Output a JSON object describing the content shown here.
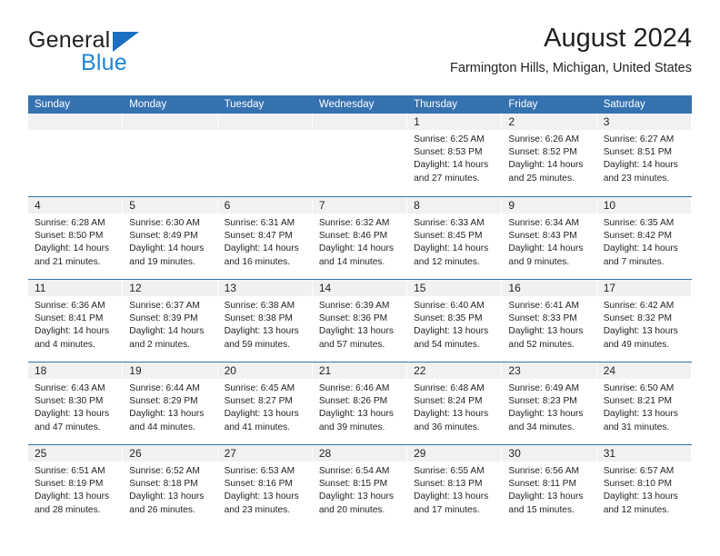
{
  "brand": {
    "name_top": "General",
    "name_bottom": "Blue",
    "triangle_color": "#1b6ec2",
    "blue_color": "#1b86d8"
  },
  "header": {
    "title": "August 2024",
    "subtitle": "Farmington Hills, Michigan, United States"
  },
  "theme": {
    "header_bar": "#3572b0",
    "day_head_bg": "#f1f1f1",
    "text": "#231f20"
  },
  "weekdays": [
    "Sunday",
    "Monday",
    "Tuesday",
    "Wednesday",
    "Thursday",
    "Friday",
    "Saturday"
  ],
  "weeks": [
    [
      {
        "day": "",
        "lines": []
      },
      {
        "day": "",
        "lines": []
      },
      {
        "day": "",
        "lines": []
      },
      {
        "day": "",
        "lines": []
      },
      {
        "day": "1",
        "lines": [
          "Sunrise: 6:25 AM",
          "Sunset: 8:53 PM",
          "Daylight: 14 hours",
          "and 27 minutes."
        ]
      },
      {
        "day": "2",
        "lines": [
          "Sunrise: 6:26 AM",
          "Sunset: 8:52 PM",
          "Daylight: 14 hours",
          "and 25 minutes."
        ]
      },
      {
        "day": "3",
        "lines": [
          "Sunrise: 6:27 AM",
          "Sunset: 8:51 PM",
          "Daylight: 14 hours",
          "and 23 minutes."
        ]
      }
    ],
    [
      {
        "day": "4",
        "lines": [
          "Sunrise: 6:28 AM",
          "Sunset: 8:50 PM",
          "Daylight: 14 hours",
          "and 21 minutes."
        ]
      },
      {
        "day": "5",
        "lines": [
          "Sunrise: 6:30 AM",
          "Sunset: 8:49 PM",
          "Daylight: 14 hours",
          "and 19 minutes."
        ]
      },
      {
        "day": "6",
        "lines": [
          "Sunrise: 6:31 AM",
          "Sunset: 8:47 PM",
          "Daylight: 14 hours",
          "and 16 minutes."
        ]
      },
      {
        "day": "7",
        "lines": [
          "Sunrise: 6:32 AM",
          "Sunset: 8:46 PM",
          "Daylight: 14 hours",
          "and 14 minutes."
        ]
      },
      {
        "day": "8",
        "lines": [
          "Sunrise: 6:33 AM",
          "Sunset: 8:45 PM",
          "Daylight: 14 hours",
          "and 12 minutes."
        ]
      },
      {
        "day": "9",
        "lines": [
          "Sunrise: 6:34 AM",
          "Sunset: 8:43 PM",
          "Daylight: 14 hours",
          "and 9 minutes."
        ]
      },
      {
        "day": "10",
        "lines": [
          "Sunrise: 6:35 AM",
          "Sunset: 8:42 PM",
          "Daylight: 14 hours",
          "and 7 minutes."
        ]
      }
    ],
    [
      {
        "day": "11",
        "lines": [
          "Sunrise: 6:36 AM",
          "Sunset: 8:41 PM",
          "Daylight: 14 hours",
          "and 4 minutes."
        ]
      },
      {
        "day": "12",
        "lines": [
          "Sunrise: 6:37 AM",
          "Sunset: 8:39 PM",
          "Daylight: 14 hours",
          "and 2 minutes."
        ]
      },
      {
        "day": "13",
        "lines": [
          "Sunrise: 6:38 AM",
          "Sunset: 8:38 PM",
          "Daylight: 13 hours",
          "and 59 minutes."
        ]
      },
      {
        "day": "14",
        "lines": [
          "Sunrise: 6:39 AM",
          "Sunset: 8:36 PM",
          "Daylight: 13 hours",
          "and 57 minutes."
        ]
      },
      {
        "day": "15",
        "lines": [
          "Sunrise: 6:40 AM",
          "Sunset: 8:35 PM",
          "Daylight: 13 hours",
          "and 54 minutes."
        ]
      },
      {
        "day": "16",
        "lines": [
          "Sunrise: 6:41 AM",
          "Sunset: 8:33 PM",
          "Daylight: 13 hours",
          "and 52 minutes."
        ]
      },
      {
        "day": "17",
        "lines": [
          "Sunrise: 6:42 AM",
          "Sunset: 8:32 PM",
          "Daylight: 13 hours",
          "and 49 minutes."
        ]
      }
    ],
    [
      {
        "day": "18",
        "lines": [
          "Sunrise: 6:43 AM",
          "Sunset: 8:30 PM",
          "Daylight: 13 hours",
          "and 47 minutes."
        ]
      },
      {
        "day": "19",
        "lines": [
          "Sunrise: 6:44 AM",
          "Sunset: 8:29 PM",
          "Daylight: 13 hours",
          "and 44 minutes."
        ]
      },
      {
        "day": "20",
        "lines": [
          "Sunrise: 6:45 AM",
          "Sunset: 8:27 PM",
          "Daylight: 13 hours",
          "and 41 minutes."
        ]
      },
      {
        "day": "21",
        "lines": [
          "Sunrise: 6:46 AM",
          "Sunset: 8:26 PM",
          "Daylight: 13 hours",
          "and 39 minutes."
        ]
      },
      {
        "day": "22",
        "lines": [
          "Sunrise: 6:48 AM",
          "Sunset: 8:24 PM",
          "Daylight: 13 hours",
          "and 36 minutes."
        ]
      },
      {
        "day": "23",
        "lines": [
          "Sunrise: 6:49 AM",
          "Sunset: 8:23 PM",
          "Daylight: 13 hours",
          "and 34 minutes."
        ]
      },
      {
        "day": "24",
        "lines": [
          "Sunrise: 6:50 AM",
          "Sunset: 8:21 PM",
          "Daylight: 13 hours",
          "and 31 minutes."
        ]
      }
    ],
    [
      {
        "day": "25",
        "lines": [
          "Sunrise: 6:51 AM",
          "Sunset: 8:19 PM",
          "Daylight: 13 hours",
          "and 28 minutes."
        ]
      },
      {
        "day": "26",
        "lines": [
          "Sunrise: 6:52 AM",
          "Sunset: 8:18 PM",
          "Daylight: 13 hours",
          "and 26 minutes."
        ]
      },
      {
        "day": "27",
        "lines": [
          "Sunrise: 6:53 AM",
          "Sunset: 8:16 PM",
          "Daylight: 13 hours",
          "and 23 minutes."
        ]
      },
      {
        "day": "28",
        "lines": [
          "Sunrise: 6:54 AM",
          "Sunset: 8:15 PM",
          "Daylight: 13 hours",
          "and 20 minutes."
        ]
      },
      {
        "day": "29",
        "lines": [
          "Sunrise: 6:55 AM",
          "Sunset: 8:13 PM",
          "Daylight: 13 hours",
          "and 17 minutes."
        ]
      },
      {
        "day": "30",
        "lines": [
          "Sunrise: 6:56 AM",
          "Sunset: 8:11 PM",
          "Daylight: 13 hours",
          "and 15 minutes."
        ]
      },
      {
        "day": "31",
        "lines": [
          "Sunrise: 6:57 AM",
          "Sunset: 8:10 PM",
          "Daylight: 13 hours",
          "and 12 minutes."
        ]
      }
    ]
  ]
}
